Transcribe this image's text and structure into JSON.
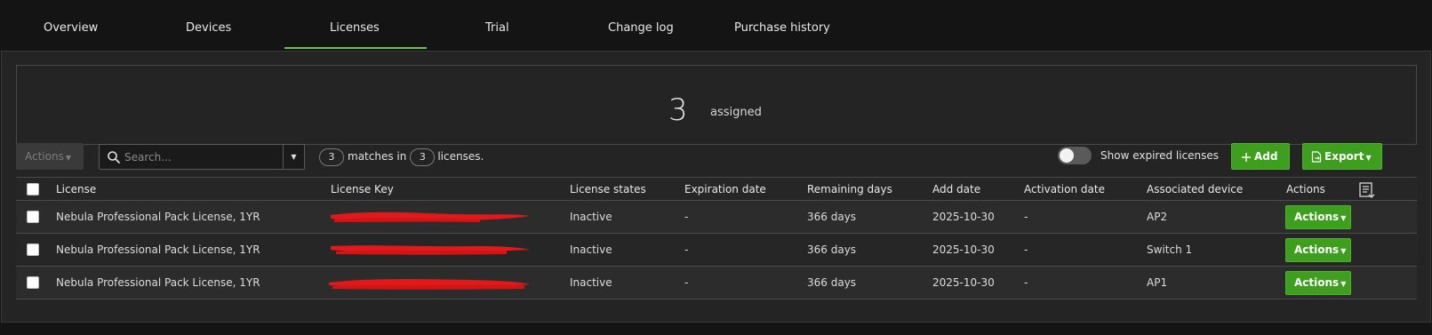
{
  "tabs": [
    {
      "label": "Overview"
    },
    {
      "label": "Devices"
    },
    {
      "label": "Licenses"
    },
    {
      "label": "Trial"
    },
    {
      "label": "Change log"
    },
    {
      "label": "Purchase history"
    }
  ],
  "active_tab": "Licenses",
  "summary": {
    "count": "3",
    "label": "assigned"
  },
  "toolbar": {
    "actions_label": "Actions",
    "search_placeholder": "Search...",
    "matches_count": "3",
    "matches_text": "matches in",
    "licenses_count": "3",
    "licenses_text": "licenses.",
    "show_expired_label": "Show expired licenses",
    "show_expired_on": false,
    "add_label": "Add",
    "export_label": "Export"
  },
  "table": {
    "headers": {
      "license": "License",
      "key": "License Key",
      "state": "License states",
      "expiration": "Expiration date",
      "remaining": "Remaining days",
      "add_date": "Add date",
      "activation": "Activation date",
      "device": "Associated device",
      "actions": "Actions"
    },
    "rows": [
      {
        "license": "Nebula Professional Pack License, 1YR",
        "state": "Inactive",
        "expiration": "-",
        "remaining": "366 days",
        "add_date": "2025-10-30",
        "activation": "-",
        "device": "AP2",
        "action": "Actions"
      },
      {
        "license": "Nebula Professional Pack License, 1YR",
        "state": "Inactive",
        "expiration": "-",
        "remaining": "366 days",
        "add_date": "2025-10-30",
        "activation": "-",
        "device": "Switch 1",
        "action": "Actions"
      },
      {
        "license": "Nebula Professional Pack License, 1YR",
        "state": "Inactive",
        "expiration": "-",
        "remaining": "366 days",
        "add_date": "2025-10-30",
        "activation": "-",
        "device": "AP1",
        "action": "Actions"
      }
    ]
  },
  "colors": {
    "accent": "#6cc24a",
    "button_green": "#3e9f1e",
    "redaction": "#e01a1a",
    "background": "#141414",
    "panel": "#242424"
  },
  "icons": [
    "search-icon",
    "chevron-down-icon",
    "plus-icon",
    "export-file-icon",
    "column-settings-icon"
  ]
}
